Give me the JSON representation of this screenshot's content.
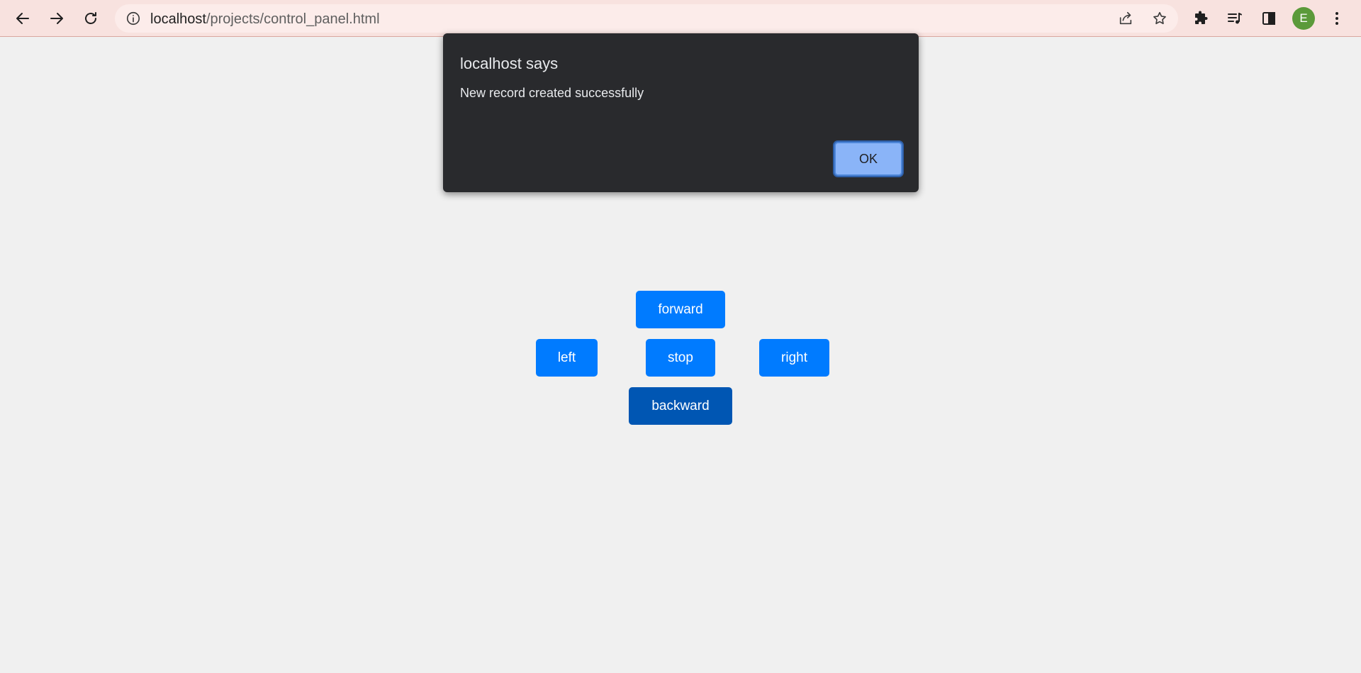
{
  "browser": {
    "url_host": "localhost",
    "url_path": "/projects/control_panel.html",
    "profile_initial": "E",
    "icons": {
      "back": "arrow-left-icon",
      "forward": "arrow-right-icon",
      "reload": "reload-icon",
      "site_info": "info-icon",
      "share": "share-icon",
      "bookmark": "star-icon",
      "extensions": "puzzle-icon",
      "media": "media-queue-icon",
      "side_panel": "side-panel-icon",
      "menu": "kebab-menu-icon"
    }
  },
  "alert": {
    "title": "localhost says",
    "message": "New record created successfully",
    "ok_label": "OK"
  },
  "controls": {
    "forward": "forward",
    "left": "left",
    "stop": "stop",
    "right": "right",
    "backward": "backward"
  },
  "colors": {
    "toolbar_bg": "#f8e2df",
    "page_bg": "#f0f0f0",
    "button_blue": "#007bff",
    "button_active": "#0056b3",
    "dialog_bg": "#292a2d",
    "dialog_ok": "#8ab4f8",
    "avatar": "#5b9a3a"
  }
}
